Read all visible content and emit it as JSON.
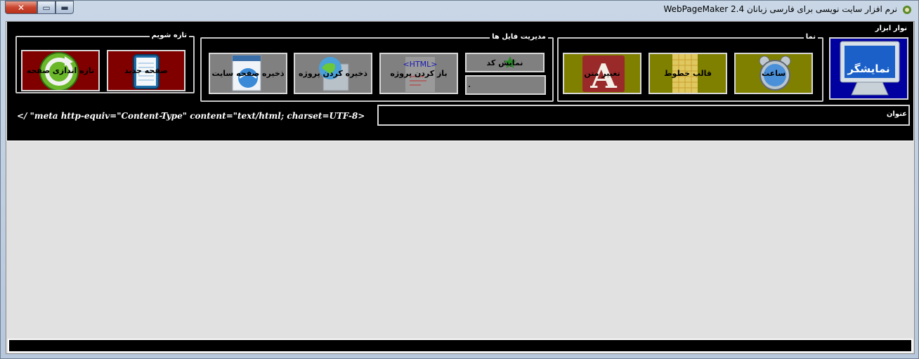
{
  "window": {
    "title": "نرم افزار سایت نویسی برای فارسی زبانان WebPageMaker 2.4",
    "close_glyph": "✕",
    "maximize_glyph": "▭",
    "minimize_glyph": "▬"
  },
  "toolbar": {
    "label": "نوار ابزار",
    "groups": {
      "new": {
        "label": "تازه شویم",
        "buttons": {
          "refresh": "تازه اندازی صفحه",
          "new_page": "صفحه جدید"
        }
      },
      "files": {
        "label": "مدیریت فایل ها",
        "buttons": {
          "save_site": "ذخیره صفحه سایت",
          "save_project": "ذخیره کردن پروژه",
          "open_project": "باز کردن پروژه",
          "show_code": "نمایش کد",
          "small_field_value": "."
        }
      },
      "view": {
        "label": "نما",
        "buttons": {
          "change_text": "تغییر متن",
          "font_template": "قالب خطوط",
          "clock": "ساعت"
        }
      }
    },
    "viewer_button": "نمایشگر",
    "meta_text": "</ \"meta http-equiv=\"Content-Type\" content=\"text/html; charset=UTF-8>",
    "title_label": "عنوان",
    "title_value": ""
  },
  "colors": {
    "toolbar_bg": "#000000",
    "maroon": "#800000",
    "olive": "#808000",
    "gray": "#808080",
    "viewer_blue": "#0000a0"
  },
  "icons": {
    "refresh": "refresh-icon",
    "new_page": "notepad-icon",
    "save_site": "document-globe-icon",
    "save_project": "globe-icon",
    "open_project": "html-file-icon",
    "show_code": "star-icon",
    "change_text": "letter-a-icon",
    "font_template": "grid-icon",
    "clock": "alarm-clock-icon",
    "viewer": "monitor-icon"
  }
}
